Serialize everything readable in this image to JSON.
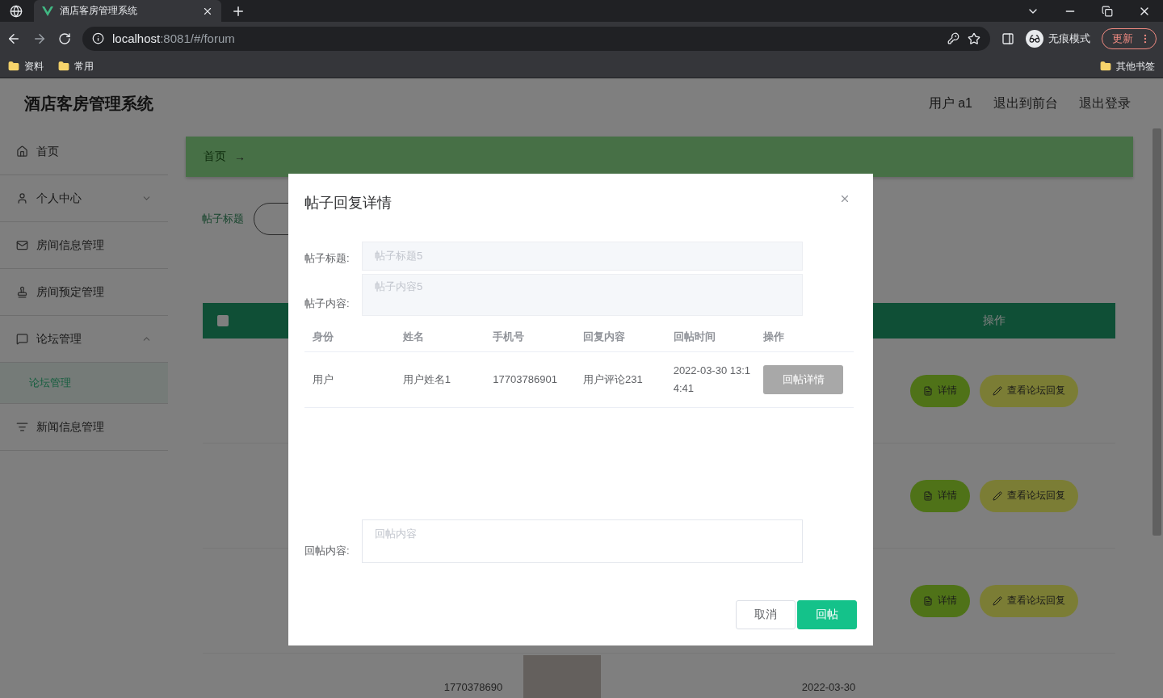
{
  "browser": {
    "tab_title": "酒店客房管理系统",
    "url_host": "localhost",
    "url_path": ":8081/#/forum",
    "profile_label": "无痕模式",
    "update_label": "更新",
    "bookmarks": [
      "资料",
      "常用"
    ],
    "other_bookmarks": "其他书签"
  },
  "header": {
    "title": "酒店客房管理系统",
    "links": [
      "用户 a1",
      "退出到前台",
      "退出登录"
    ]
  },
  "sidebar": {
    "items": [
      {
        "label": "首页"
      },
      {
        "label": "个人中心",
        "expanded": false
      },
      {
        "label": "房间信息管理"
      },
      {
        "label": "房间预定管理"
      },
      {
        "label": "论坛管理",
        "expanded": true,
        "children": [
          {
            "label": "论坛管理",
            "selected": true
          }
        ]
      },
      {
        "label": "新闻信息管理"
      }
    ]
  },
  "breadcrumb": {
    "items": [
      "首页"
    ],
    "separator": "→"
  },
  "search": {
    "label": "帖子标题"
  },
  "table": {
    "select_all_checked": false,
    "action_header": "操作",
    "rows": [
      {
        "actions": [
          "详情",
          "查看论坛回复"
        ]
      },
      {
        "actions": [
          "详情",
          "查看论坛回复"
        ]
      },
      {
        "actions": [
          "详情",
          "查看论坛回复"
        ]
      },
      {
        "phone": "1770378690",
        "photo": true,
        "time": "2022-03-30"
      }
    ]
  },
  "dialog": {
    "title": "帖子回复详情",
    "fields": [
      {
        "label": "帖子标题:",
        "value": "帖子标题5",
        "kind": "input"
      },
      {
        "label": "帖子内容:",
        "value": "帖子内容5",
        "kind": "textarea"
      }
    ],
    "columns": [
      "身份",
      "姓名",
      "手机号",
      "回复内容",
      "回帖时间",
      "操作"
    ],
    "rows": [
      {
        "cells": [
          "用户",
          "用户姓名1",
          "17703786901",
          "用户评论231",
          "2022-03-30 13:14:41"
        ],
        "action": "回帖详情"
      }
    ],
    "reply": {
      "label": "回帖内容:",
      "placeholder": "回帖内容"
    },
    "buttons": [
      {
        "label": "取消",
        "kind": "secondary"
      },
      {
        "label": "回帖",
        "kind": "primary"
      }
    ]
  }
}
